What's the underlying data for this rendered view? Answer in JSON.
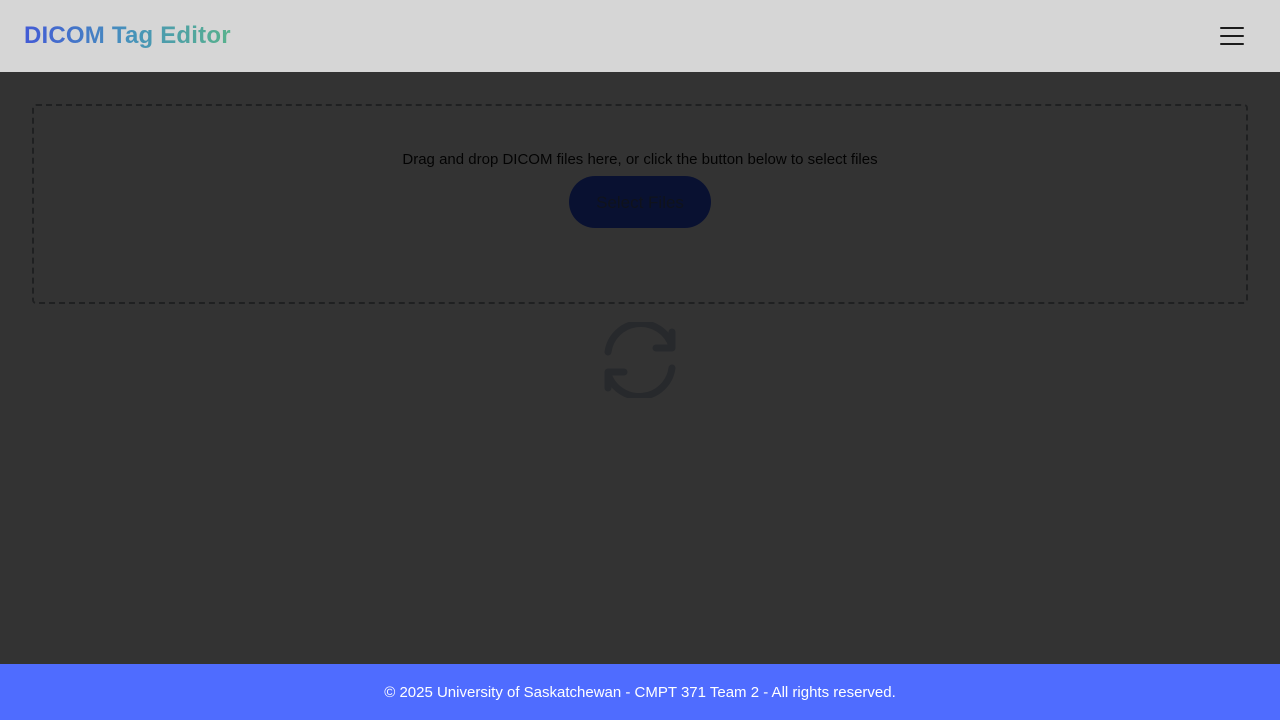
{
  "header": {
    "brand": "DICOM Tag Editor",
    "menu_icon": "hamburger-menu-icon"
  },
  "dropzone": {
    "instruction": "Drag and drop DICOM files here, or click the button below to select files",
    "button_label": "Select Files"
  },
  "loading": {
    "icon": "refresh-icon"
  },
  "footer": {
    "text": "© 2025 University of Saskatchewan - CMPT 371 Team 2 - All rights reserved."
  },
  "colors": {
    "accent": "#4f6cff",
    "button": "#2f56f5",
    "footer": "#4f6cff"
  }
}
